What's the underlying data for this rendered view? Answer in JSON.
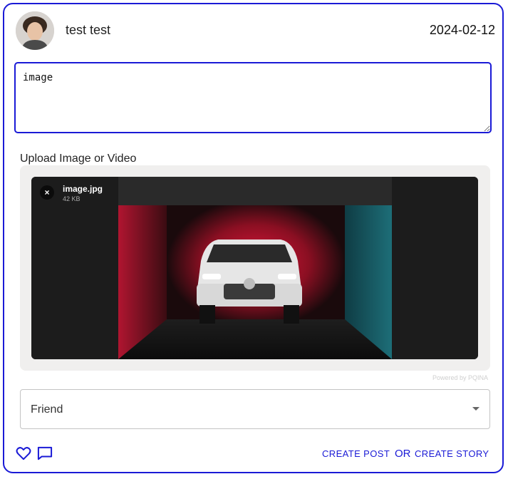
{
  "header": {
    "username": "test test",
    "date": "2024-02-12"
  },
  "post": {
    "text": "image"
  },
  "upload": {
    "label": "Upload Image or Video",
    "file_name": "image.jpg",
    "file_size": "42 KB",
    "remove_icon": "×",
    "powered_by": "Powered by PQINA"
  },
  "audience": {
    "selected": "Friend"
  },
  "actions": {
    "create_post": "CREATE POST",
    "or": "OR",
    "create_story": "CREATE STORY"
  },
  "colors": {
    "accent": "#1a1ad6"
  }
}
